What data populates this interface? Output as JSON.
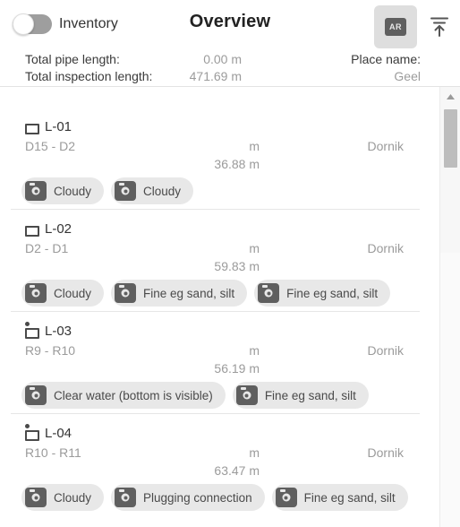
{
  "header": {
    "toggle_label": "Inventory",
    "toggle_state": "off",
    "title": "Overview",
    "ar_button_label": "AR",
    "export_icon": "upload-icon",
    "stats": [
      {
        "label": "Total pipe length:",
        "value": "0.00 m"
      },
      {
        "label": "Total inspection length:",
        "value": "471.69 m"
      }
    ],
    "place": {
      "label": "Place name:",
      "value": "Geel"
    }
  },
  "list": {
    "items": [
      {
        "name": "L-01",
        "icon": "pipe-section-icon",
        "has_marker": false,
        "nodes": "D15 - D2",
        "unit": "m",
        "length": "36.88 m",
        "place": "Dornik",
        "tags": [
          "Cloudy",
          "Cloudy"
        ]
      },
      {
        "name": "L-02",
        "icon": "pipe-section-icon",
        "has_marker": false,
        "nodes": "D2 - D1",
        "unit": "m",
        "length": "59.83 m",
        "place": "Dornik",
        "tags": [
          "Cloudy",
          "Fine eg sand, silt",
          "Fine eg sand, silt"
        ]
      },
      {
        "name": "L-03",
        "icon": "pipe-section-marker-icon",
        "has_marker": true,
        "nodes": "R9 - R10",
        "unit": "m",
        "length": "56.19 m",
        "place": "Dornik",
        "tags": [
          "Clear water (bottom is visible)",
          "Fine eg sand, silt"
        ]
      },
      {
        "name": "L-04",
        "icon": "pipe-section-marker-icon",
        "has_marker": true,
        "nodes": "R10 - R11",
        "unit": "m",
        "length": "63.47 m",
        "place": "Dornik",
        "tags": [
          "Cloudy",
          "Plugging connection",
          "Fine eg sand, silt"
        ]
      }
    ]
  },
  "scrollbar": {
    "up_arrow_icon": "chevron-up-icon"
  },
  "colors": {
    "background": "#ffffff",
    "muted_text": "#9b9b9b",
    "primary_text": "#333333",
    "pill_background": "#e8e8e8",
    "pill_icon": "#5f5f5f",
    "ar_button_background": "#dedede",
    "divider": "#e6e6e6",
    "scrollbar_thumb": "#bdbdbd"
  }
}
